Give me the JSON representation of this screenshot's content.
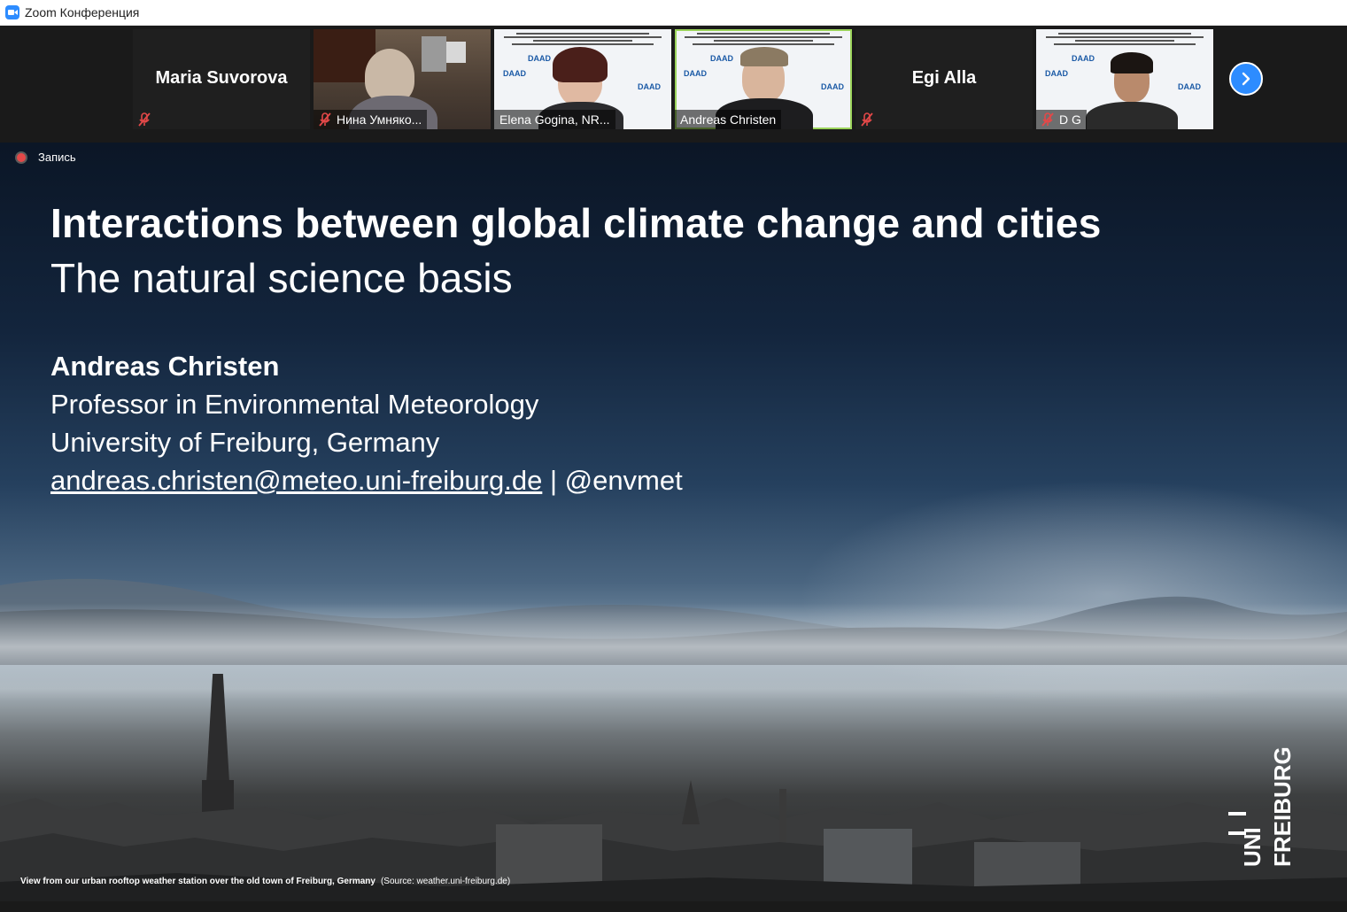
{
  "window": {
    "title": "Zoom Конференция"
  },
  "participants": [
    {
      "name": "Maria Suvorova",
      "display": "name-only",
      "muted": true
    },
    {
      "name": "Нина Умняко...",
      "display": "video",
      "muted": true
    },
    {
      "name": "Elena Gogina, NR...",
      "display": "video",
      "muted": false
    },
    {
      "name": "Andreas Christen",
      "display": "video",
      "muted": false,
      "active": true
    },
    {
      "name": "Egi Alla",
      "display": "name-only",
      "muted": true
    },
    {
      "name": "D G",
      "display": "video",
      "muted": true
    }
  ],
  "icons": {
    "next": "chevron-right-icon",
    "mute": "microphone-muted-icon",
    "recording": "record-dot-icon"
  },
  "recording": {
    "label": "Запись"
  },
  "slide": {
    "title": "Interactions between global climate change and cities",
    "subtitle": "The natural science basis",
    "author": "Andreas Christen",
    "role": "Professor in Environmental Meteorology",
    "university": "University of Freiburg, Germany",
    "email": "andreas.christen@meteo.uni-freiburg.de",
    "separator": " | ",
    "handle": "@envmet",
    "caption_bold": "View from our urban rooftop weather station over the old town of Freiburg, Germany",
    "caption_source": "(Source: weather.uni-freiburg.de)",
    "logo_text_1": "UNI",
    "logo_text_2": "FREIBURG",
    "backdrop_logo": "DAAD"
  },
  "colors": {
    "zoom_blue": "#2d8cff",
    "mute_red": "#e34848",
    "active_border": "#9bd35a"
  }
}
